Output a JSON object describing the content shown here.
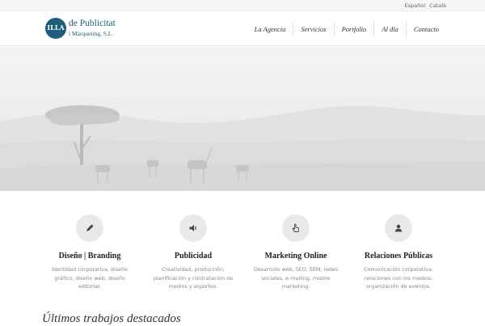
{
  "languages": [
    "Español",
    "Català"
  ],
  "logo": {
    "mark": "ILLA",
    "line1": "de Publicitat",
    "line2": "i Màrqueting, S.L."
  },
  "nav": [
    "La Agencia",
    "Servicios",
    "Portfolio",
    "Al día",
    "Contacto"
  ],
  "hero": {
    "image": "african savanna landscape with acacia tree and zebras"
  },
  "services": [
    {
      "title": "Diseño | Branding",
      "text": "Identidad corporativa, diseño gráfico, diseño web, diseño editorial.",
      "icon": "pencil-icon"
    },
    {
      "title": "Publicidad",
      "text": "Creatividad, producción, planificación y contratación de medios y soportes.",
      "icon": "speaker-icon"
    },
    {
      "title": "Marketing Online",
      "text": "Desarrollo web, SEO, SEM, redes sociales, e-mailing, mobile marketing.",
      "icon": "pointer-hand-icon"
    },
    {
      "title": "Relaciones Públicas",
      "text": "Comunicación corporativa, relaciones con los medios, organización de eventos.",
      "icon": "user-icon"
    }
  ],
  "section_title": "Últimos trabajos destacados",
  "colors": {
    "brand": "#1f5d7a",
    "icon_circle": "#e9e9e9",
    "hero_bg": "#ececec"
  }
}
